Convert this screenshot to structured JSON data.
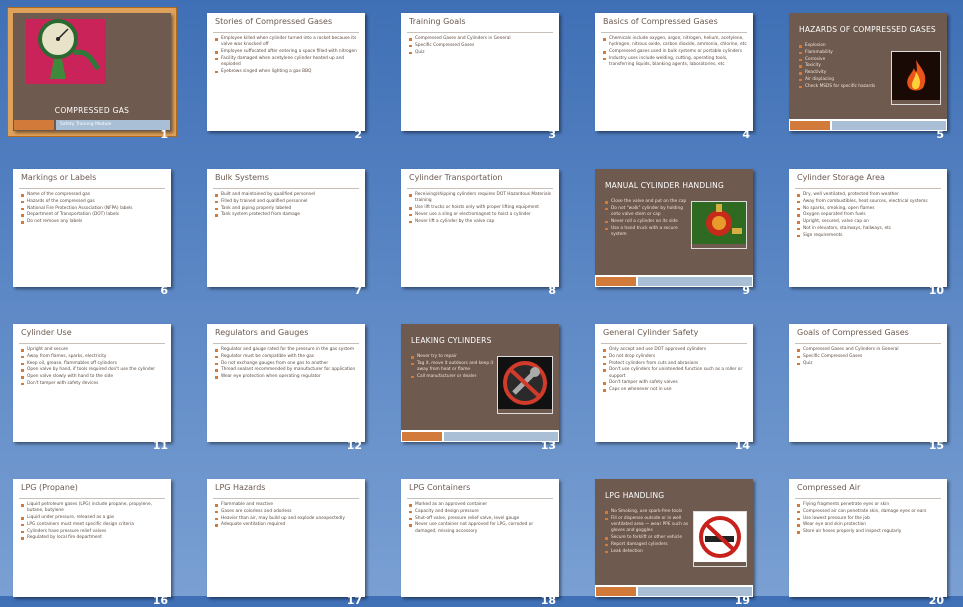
{
  "slides": [
    {
      "n": "1",
      "type": "title",
      "title": "COMPRESSED GAS",
      "subtitle": "Safety Training Module",
      "selected": true,
      "pic": "gauge-photo"
    },
    {
      "n": "2",
      "type": "content",
      "title": "Stories of Compressed Gases",
      "bullets": [
        "Employee killed when cylinder turned into a rocket because its valve was knocked off",
        "Employee suffocated after entering a space filled with nitrogen",
        "Facility damaged when acetylene cylinder heated up and exploded",
        "Eyebrows singed when lighting a gas BBQ"
      ]
    },
    {
      "n": "3",
      "type": "content",
      "title": "Training Goals",
      "bullets": [
        "Compressed Gases and Cylinders in General",
        "Specific Compressed Gases",
        "Quiz"
      ]
    },
    {
      "n": "4",
      "type": "content",
      "title": "Basics of Compressed Gases",
      "bullets": [
        "Chemicals include oxygen, argon, nitrogen, helium, acetylene, hydrogen, nitrous oxide, carbon dioxide, ammonia, chlorine, etc",
        "Compressed gases used in bulk systems or portable cylinders",
        "Industry uses include welding, cutting, operating tools, transferring liquids, blanking agents, laboratories, etc"
      ]
    },
    {
      "n": "5",
      "type": "dark",
      "title": "HAZARDS OF COMPRESSED GASES",
      "bullets": [
        "Explosion",
        "Flammability",
        "Corrosive",
        "Toxicity",
        "Reactivity",
        "Air displacing",
        "Check MSDS for specific hazards"
      ],
      "pic": "fire-photo"
    },
    {
      "n": "6",
      "type": "content",
      "title": "Markings or Labels",
      "bullets": [
        "Name of the compressed gas",
        "Hazards of the compressed gas",
        "National Fire Protection Association (NFPA) labels",
        "Department of Transportation (DOT) labels",
        "Do not remove any labels"
      ]
    },
    {
      "n": "7",
      "type": "content",
      "title": "Bulk Systems",
      "bullets": [
        "Built and maintained by qualified personnel",
        "Filled by trained and qualified personnel",
        "Tank and piping properly labeled",
        "Tank system protected from damage"
      ]
    },
    {
      "n": "8",
      "type": "content",
      "title": "Cylinder Transportation",
      "bullets": [
        "Receiving/shipping cylinders requires DOT Hazardous Materials training",
        "Use lift trucks or hoists only with proper lifting equipment",
        "Never use a sling or electromagnet to hoist a cylinder",
        "Never lift a cylinder by the valve cap"
      ]
    },
    {
      "n": "9",
      "type": "dark",
      "title": "MANUAL CYLINDER HANDLING",
      "bullets": [
        "Close the valve and put on the cap",
        "Do not \"walk\" cylinder by holding onto valve stem or cap",
        "Never roll a cylinder on its side",
        "Use a hand truck with a secure system"
      ],
      "pic": "cylinder-photo"
    },
    {
      "n": "10",
      "type": "content",
      "title": "Cylinder Storage Area",
      "bullets": [
        "Dry, well ventilated, protected from weather",
        "Away from combustibles, heat sources, electrical systems",
        "No sparks, smoking, open flames",
        "Oxygen separated from fuels",
        "Upright, secured, valve cap on",
        "Not in elevators, stairways, hallways, etc",
        "Sign requirements"
      ]
    },
    {
      "n": "11",
      "type": "content",
      "title": "Cylinder Use",
      "bullets": [
        "Upright and secure",
        "Away from flames, sparks, electricity",
        "Keep oil, grease, flammables off cylinders",
        "Open valve by hand, if tools required don't use the cylinder",
        "Open valve slowly with hand to the side",
        "Don't tamper with safety devices"
      ]
    },
    {
      "n": "12",
      "type": "content",
      "title": "Regulators and Gauges",
      "bullets": [
        "Regulator and gauge rated for the pressure in the gas system",
        "Regulator must be compatible with the gas",
        "Do not exchange gauges from one gas to another",
        "Thread sealant recommended by manufacturer for application",
        "Wear eye protection when operating regulator"
      ]
    },
    {
      "n": "13",
      "type": "dark",
      "title": "LEAKING CYLINDERS",
      "bullets": [
        "Never try to repair",
        "Tag it, move it outdoors and keep it away from heat or flame",
        "Call manufacturer or dealer"
      ],
      "pic": "no-wrench-photo"
    },
    {
      "n": "14",
      "type": "content",
      "title": "General Cylinder Safety",
      "bullets": [
        "Only accept and use DOT approved cylinders",
        "Do not drop cylinders",
        "Protect cylinders from cuts and abrasions",
        "Don't use cylinders for unintended function such as a roller or support",
        "Don't tamper with safety valves",
        "Caps on whenever not in use"
      ]
    },
    {
      "n": "15",
      "type": "content",
      "title": "Goals of Compressed Gases",
      "bullets": [
        "Compressed Gases and Cylinders in General",
        "Specific Compressed Gases",
        "Quiz"
      ]
    },
    {
      "n": "16",
      "type": "content",
      "title": "LPG (Propane)",
      "bullets": [
        "Liquid petroleum gases (LPG) include propane, propylene, butane, butylene",
        "Liquid under pressure, released as a gas",
        "LPG containers must meet specific design criteria",
        "Cylinders have pressure relief valves",
        "Regulated by local fire department"
      ]
    },
    {
      "n": "17",
      "type": "content",
      "title": "LPG Hazards",
      "bullets": [
        "Flammable and reactive",
        "Gases are colorless and odorless",
        "Heavier than air, may build up and explode unexpectedly",
        "Adequate ventilation required"
      ]
    },
    {
      "n": "18",
      "type": "content",
      "title": "LPG Containers",
      "bullets": [
        "Marked as an approved container",
        "Capacity and design pressure",
        "Shut-off valve, pressure relief valve, level gauge",
        "Never use container not approved for LPG, corroded or damaged, missing accessory"
      ]
    },
    {
      "n": "19",
      "type": "dark",
      "title": "LPG HANDLING",
      "bullets": [
        "No Smoking, use spark-free tools",
        "Fill or dispense outside or in well ventilated area — wear PPE such as gloves and goggles",
        "Secure to forklift or other vehicle",
        "Report damaged cylinders",
        "Leak detection"
      ],
      "pic": "no-smoking-photo"
    },
    {
      "n": "20",
      "type": "content",
      "title": "Compressed Air",
      "bullets": [
        "Flying fragments penetrate eyes or skin",
        "Compressed air can penetrate skin, damage eyes or ears",
        "Use lowest pressure for the job",
        "Wear eye and skin protection",
        "Store air hoses properly and inspect regularly"
      ]
    }
  ]
}
